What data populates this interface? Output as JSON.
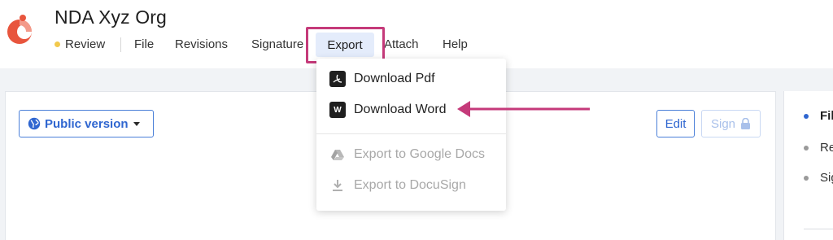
{
  "header": {
    "doc_title": "NDA Xyz Org",
    "status_label": "Review",
    "status_color": "#f2c94c",
    "logo_icon": "app-logo-icon",
    "nav": [
      "File",
      "Revisions",
      "Signature",
      "Export",
      "Attach",
      "Help"
    ],
    "active_tab": "Export",
    "highlight_color": "#c53a7a"
  },
  "export_menu": {
    "items": [
      {
        "label": "Download Pdf",
        "icon": "pdf-icon",
        "enabled": true
      },
      {
        "label": "Download Word",
        "icon": "word-icon",
        "icon_text": "W",
        "enabled": true
      },
      {
        "label": "Export to Google Docs",
        "icon": "google-drive-icon",
        "enabled": false
      },
      {
        "label": "Export to DocuSign",
        "icon": "download-icon",
        "enabled": false
      }
    ]
  },
  "toolbar": {
    "version_selector": "Public version",
    "edit_label": "Edit",
    "sign_label": "Sign"
  },
  "side_panel": {
    "items": [
      "Fil",
      "Re",
      "Sig"
    ],
    "accent_color": "#2f66d0"
  }
}
